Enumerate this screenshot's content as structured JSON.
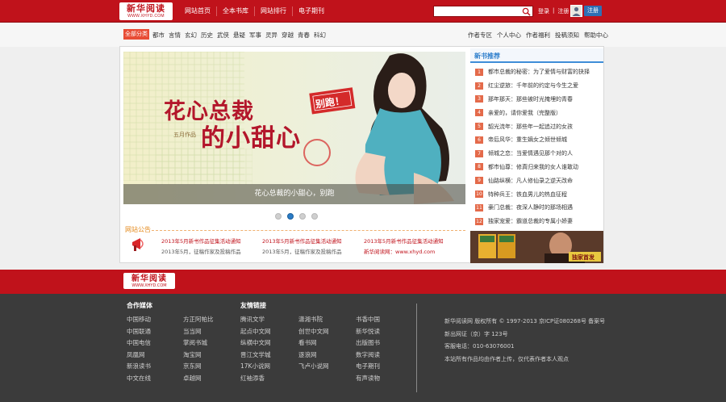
{
  "logo": {
    "cn": "新华阅读",
    "en": "WWW.XHYD.COM"
  },
  "topnav": [
    "网站首页",
    "全本书库",
    "网站排行",
    "电子期刊"
  ],
  "search": {
    "placeholder": ""
  },
  "login": {
    "login": "登录",
    "separator": "|",
    "register_link": "注册",
    "register_button": "注册"
  },
  "category": {
    "label": "全部分类",
    "items": [
      "都市",
      "言情",
      "玄幻",
      "历史",
      "武侠",
      "悬疑",
      "军事",
      "灵异",
      "穿越",
      "青春",
      "科幻"
    ],
    "right": [
      "作者专区",
      "个人中心",
      "作者福利",
      "投稿须知",
      "帮助中心"
    ]
  },
  "banner": {
    "title_line1": "花心总裁",
    "title_line2": "的小甜心",
    "stamp": "别跑！",
    "author": "五月作品",
    "caption": "花心总裁的小甜心，别跑",
    "dots_total": 4,
    "dots_active_index": 1
  },
  "ranking": {
    "title": "新书推荐",
    "items": [
      {
        "num": "1",
        "text": "都市总裁的秘密：为了爱情与财富的抉择"
      },
      {
        "num": "2",
        "text": "红尘逆旅：千年前的约定与今生之爱"
      },
      {
        "num": "3",
        "text": "那年那天：那些被时光掩埋的青春"
      },
      {
        "num": "4",
        "text": "亲爱的，请你爱我（完整版）"
      },
      {
        "num": "5",
        "text": "韶光流年：那些年一起追过的女孩"
      },
      {
        "num": "6",
        "text": "帝后风华：重生嫡女之倾世倾城"
      },
      {
        "num": "7",
        "text": "倾城之恋：当爱情遇见那个对的人"
      },
      {
        "num": "8",
        "text": "都市仙尊：修真归来我的女人谁敢动"
      },
      {
        "num": "9",
        "text": "仙路纵横：凡人修仙录之逆天改命"
      },
      {
        "num": "10",
        "text": "特种兵王：铁血男儿的热血征程"
      },
      {
        "num": "11",
        "text": "豪门总裁：夜深人静时的那场相遇"
      },
      {
        "num": "12",
        "text": "独家宠爱：霸道总裁的专属小娇妻"
      }
    ]
  },
  "notice": {
    "title": "网站公告",
    "columns": [
      [
        "2013年5月新书作品征集活动通知",
        "2013年5月，征稿作家及投稿作品"
      ],
      [
        "2013年5月新书作品征集活动通知",
        "2013年5月，征稿作家及投稿作品"
      ],
      [
        "2013年5月新书作品征集活动通知",
        "新华阅读网：www.xhyd.com"
      ]
    ]
  },
  "promo": {
    "label": "独家首发"
  },
  "footer": {
    "partners_title": "合作媒体",
    "partners_col1": [
      "中国移动",
      "中国联通",
      "中国电信",
      "凤凰网",
      "新浪读书",
      "中文在线"
    ],
    "partners_col2": [
      "方正阿帕比",
      "当当网",
      "掌阅书城",
      "淘宝网",
      "京东网",
      "卓越网"
    ],
    "links_title": "友情链接",
    "links_col1": [
      "腾讯文学",
      "起点中文网",
      "纵横中文网",
      "晋江文学城",
      "17K小说网",
      "红袖添香"
    ],
    "links_col2": [
      "潇湘书院",
      "创世中文网",
      "看书网",
      "逐浪网",
      "飞卢小说网"
    ],
    "links_col3": [
      "书香中国",
      "新华悦读",
      "出版图书",
      "数字阅读",
      "电子期刊",
      "有声读物"
    ],
    "info": [
      "新华阅读网 版权所有 © 1997-2013 京ICP证080268号 备案号",
      "新出网证（京）字 123号",
      "客服电话：010-63076001",
      "本站所有作品均由作者上传，仅代表作者本人观点"
    ]
  }
}
